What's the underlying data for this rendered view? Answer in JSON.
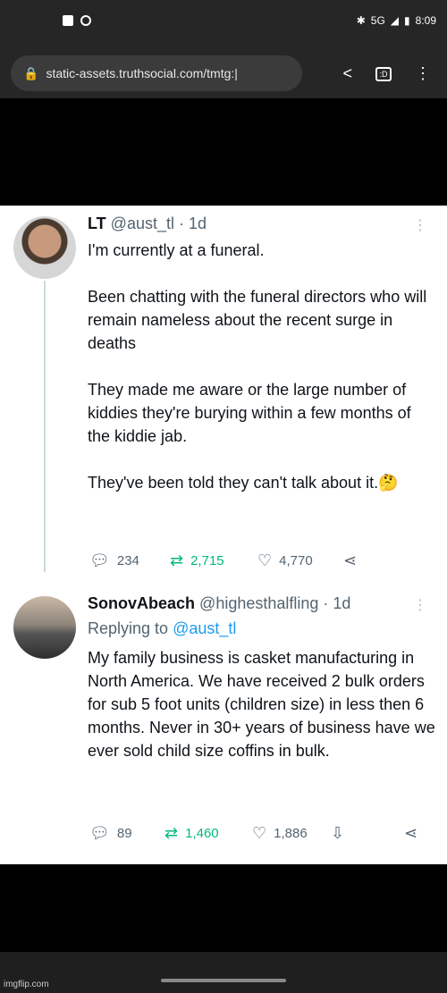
{
  "status_bar": {
    "time": "8:09",
    "network": "5G",
    "bluetooth_icon": "bluetooth-icon"
  },
  "browser": {
    "url": "static-assets.truthsocial.com/tmtg:|"
  },
  "tweets": [
    {
      "display_name": "LT",
      "handle": "@aust_tl",
      "time": "· 1d",
      "paragraphs": [
        "I'm currently at a funeral.",
        "Been chatting with the funeral directors who will remain nameless about the recent surge in deaths",
        "They made me aware or the large number of kiddies they're burying within a few months of the kiddie jab.",
        "They've been told they can't talk about it.🤔"
      ],
      "replies": "234",
      "retweets": "2,715",
      "likes": "4,770"
    },
    {
      "display_name": "SonovAbeach",
      "handle": "@highesthalfling",
      "time": "· 1d",
      "replying_prefix": "Replying to",
      "replying_to": "@aust_tl",
      "paragraphs": [
        "My family business is casket manufacturing in North America. We have received 2 bulk orders for sub 5 foot units (children size) in less then 6 months. Never in 30+ years of business have we ever sold child size coffins in bulk."
      ],
      "replies": "89",
      "retweets": "1,460",
      "likes": "1,886"
    }
  ],
  "watermark": "imgflip.com",
  "colors": {
    "link": "#1d9bf0",
    "retweet": "#00ba7c",
    "secondary": "#536471"
  }
}
